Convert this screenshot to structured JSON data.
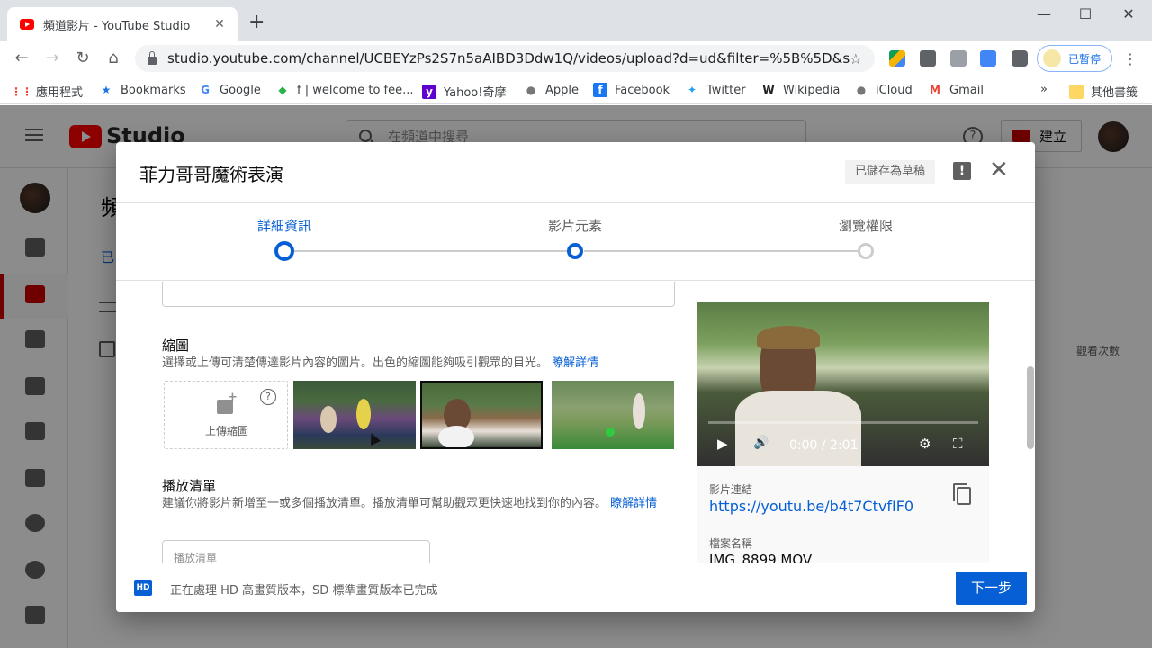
{
  "browser": {
    "tab_title": "頻道影片 - YouTube Studio",
    "tab_close": "✕",
    "new_tab": "+",
    "window_controls": [
      "—",
      "☐",
      "✕"
    ],
    "url": "studio.youtube.com/channel/UCBEYzPs2S7n5aAIBD3Ddw1Q/videos/upload?d=ud&filter=%5B%5D&sor...",
    "profile_status": "已暫停",
    "bookmarks": [
      "應用程式",
      "Bookmarks",
      "Google",
      "f | welcome to fee...",
      "Yahoo!奇摩",
      "Apple",
      "Facebook",
      "Twitter",
      "Wikipedia",
      "iCloud",
      "Gmail"
    ],
    "bookmarks_more": "»",
    "other_bookmarks": "其他書籤"
  },
  "studio": {
    "brand": "Studio",
    "search_placeholder": "在頻道中搜尋",
    "create_label": "建立",
    "page_title": "頻",
    "tab_label": "已",
    "column_head": "觀看次數"
  },
  "dialog": {
    "title": "菲力哥哥魔術表演",
    "draft_label": "已儲存為草稿",
    "feedback_icon": "!",
    "close_icon": "✕",
    "steps": [
      "詳細資訊",
      "影片元素",
      "瀏覽權限"
    ],
    "thumbnail": {
      "title": "縮圖",
      "desc": "選擇或上傳可清楚傳達影片內容的圖片。出色的縮圖能夠吸引觀眾的目光。",
      "link": "瞭解詳情",
      "upload_label": "上傳縮圖",
      "help": "?"
    },
    "playlist": {
      "title": "播放清單",
      "desc": "建議你將影片新增至一或多個播放清單。播放清單可幫助觀眾更快速地找到你的內容。",
      "link": "瞭解詳情",
      "placeholder": "播放清單"
    },
    "video": {
      "time": "0:00 / 2:01",
      "progress": 0,
      "play_icon": "▶",
      "volume_icon": "🔊",
      "settings_icon": "⚙",
      "fullscreen_icon": "⛶"
    },
    "link_label": "影片連結",
    "link_url": "https://youtu.be/b4t7CtvfIF0",
    "file_label": "檔案名稱",
    "file_name": "IMG_8899.MOV",
    "hd_badge": "HD",
    "status": "正在處理 HD 高畫質版本，SD 標準畫質版本已完成",
    "next_button": "下一步"
  }
}
